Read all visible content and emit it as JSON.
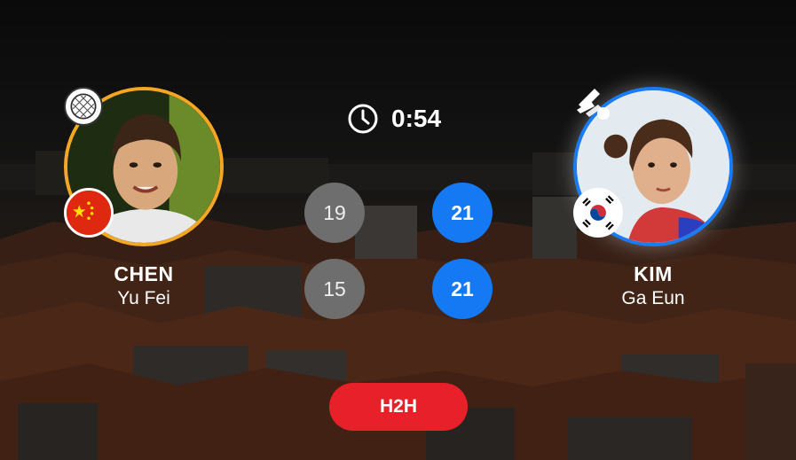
{
  "timer": {
    "icon": "clock-icon",
    "value": "0:54"
  },
  "players": [
    {
      "side": "left",
      "surname": "CHEN",
      "firstname": "Yu Fei",
      "country_flag_icon": "china-flag-icon",
      "badge_icon": "racket-icon",
      "ring_color": "#f5a623"
    },
    {
      "side": "right",
      "surname": "KIM",
      "firstname": "Ga Eun",
      "country_flag_icon": "south-korea-flag-icon",
      "badge_icon": "shuttlecock-icon",
      "ring_color": "#1a7cf5"
    }
  ],
  "games": [
    {
      "left_score": "19",
      "right_score": "21"
    },
    {
      "left_score": "15",
      "right_score": "21"
    }
  ],
  "h2h_button": {
    "label": "H2H",
    "color": "#e8202a"
  },
  "colors": {
    "win": "#1479f2",
    "lose": "#6e6e6e"
  }
}
